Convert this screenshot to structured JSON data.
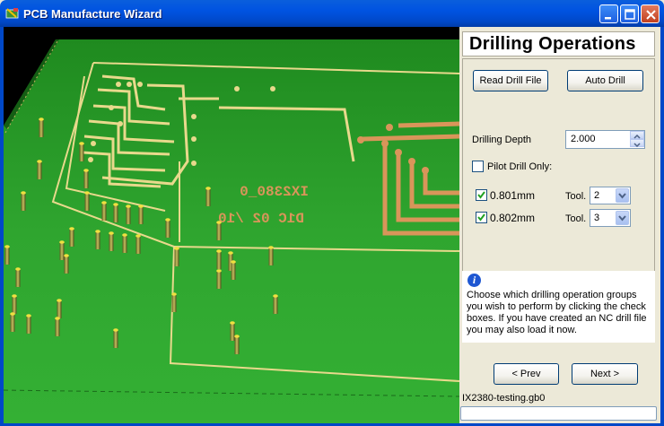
{
  "window": {
    "title": "PCB Manufacture Wizard"
  },
  "panel": {
    "heading": "Drilling Operations",
    "read_drill_button": "Read Drill File",
    "auto_drill_button": "Auto Drill",
    "drilling_depth_label": "Drilling Depth",
    "drilling_depth_value": "2.000",
    "pilot_drill_label": "Pilot Drill Only:",
    "pilot_drill_checked": false,
    "tools": [
      {
        "size": "0.801mm",
        "checked": true,
        "tool_label": "Tool.",
        "tool_value": "2"
      },
      {
        "size": "0.802mm",
        "checked": true,
        "tool_label": "Tool.",
        "tool_value": "3"
      }
    ],
    "info_text": "Choose which drilling operation groups you wish to perform by clicking the check boxes. If you have created an NC drill file you may also load it now.",
    "prev_button": "< Prev",
    "next_button": "Next >",
    "filename": "IX2380-testing.gb0",
    "status_value": ""
  },
  "board": {
    "silk_line1": "IX2380_0",
    "silk_line2": "D1C 02 /10"
  },
  "colors": {
    "board_green": "#2E9E2E",
    "silkscreen": "#E8D98C",
    "copper": "#D9955A",
    "accent_blue": "#0053E1"
  }
}
